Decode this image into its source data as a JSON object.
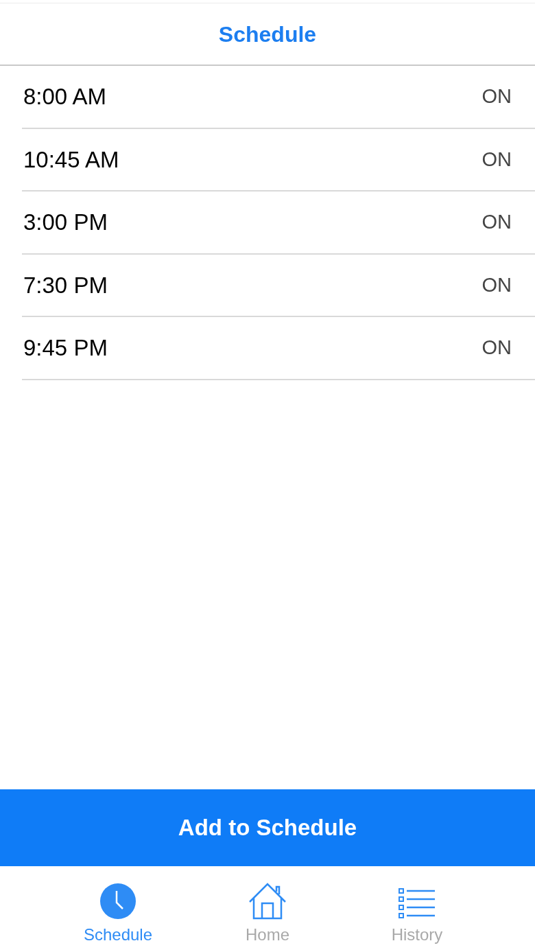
{
  "header": {
    "title": "Schedule"
  },
  "schedule": [
    {
      "time": "8:00 AM",
      "status": "ON"
    },
    {
      "time": "10:45 AM",
      "status": "ON"
    },
    {
      "time": "3:00 PM",
      "status": "ON"
    },
    {
      "time": "7:30 PM",
      "status": "ON"
    },
    {
      "time": "9:45 PM",
      "status": "ON"
    }
  ],
  "add_button": "Add to Schedule",
  "tab_bar": [
    {
      "label": "Schedule",
      "kind": "clock",
      "selected": true
    },
    {
      "label": "Home",
      "kind": "house",
      "selected": false
    },
    {
      "label": "History",
      "kind": "list",
      "selected": false
    }
  ]
}
